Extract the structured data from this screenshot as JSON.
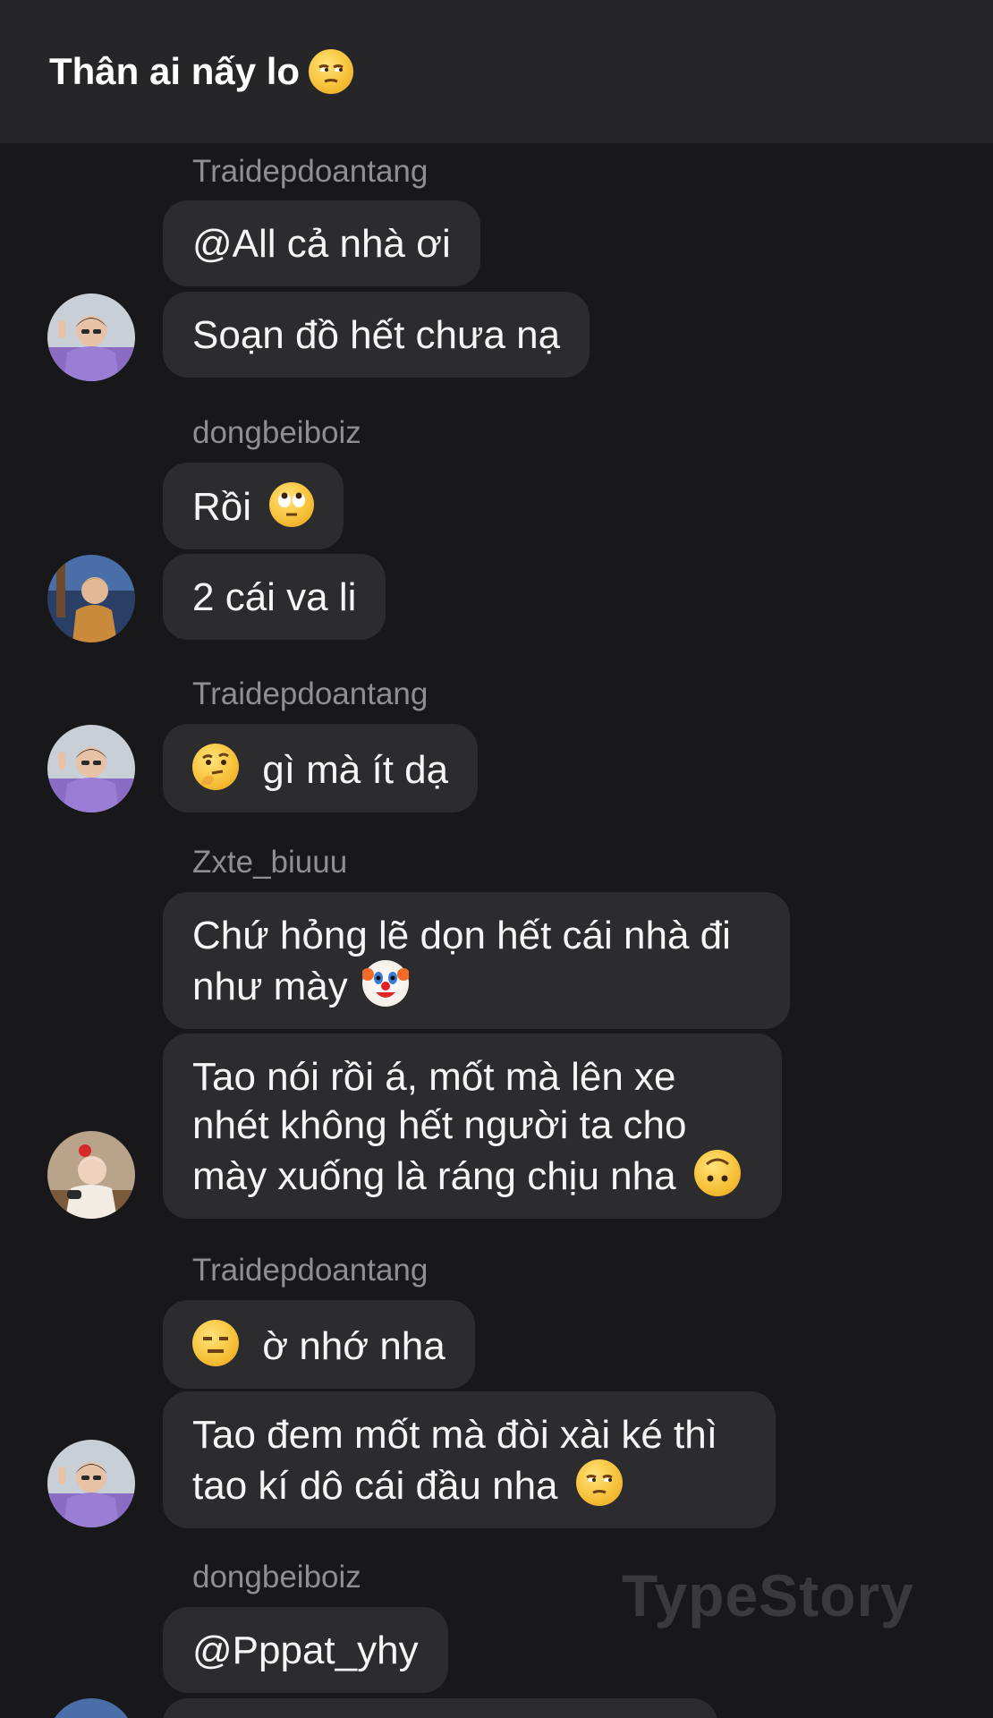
{
  "header": {
    "title": "Thân ai nấy lo",
    "title_emoji": "unamused-face"
  },
  "messages": [
    {
      "sender": "Traidepdoantang",
      "bubbles": [
        "@All cả nhà ơi",
        "Soạn đồ hết chưa nạ"
      ],
      "avatar": "avatar-traidepdoantang"
    },
    {
      "sender": "dongbeiboiz",
      "bubbles": [
        "Rồi",
        "2 cái va li"
      ],
      "emoji_1": "rolling-eyes",
      "avatar": "avatar-dongbeiboiz"
    },
    {
      "sender": "Traidepdoantang",
      "bubbles": [
        "gì mà ít dạ"
      ],
      "emoji_1": "thinking-face",
      "avatar": "avatar-traidepdoantang"
    },
    {
      "sender": "Zxte_biuuu",
      "bubbles": [
        "Chứ hỏng lẽ dọn hết cái nhà đi như mày",
        "Tao nói rồi á, mốt mà lên xe nhét không hết người ta cho mày xuống là ráng chịu nha"
      ],
      "emoji_1": "clown-face",
      "emoji_2": "upside-down-face",
      "avatar": "avatar-zxte"
    },
    {
      "sender": "Traidepdoantang",
      "bubbles": [
        "ờ nhớ nha",
        "Tao đem mốt mà đòi xài ké thì tao kí dô cái đầu nha"
      ],
      "emoji_1": "expressionless-face",
      "emoji_2": "unamused-face",
      "avatar": "avatar-traidepdoantang"
    },
    {
      "sender": "dongbeiboiz",
      "bubbles": [
        "@Pppat_yhy"
      ],
      "avatar": "avatar-dongbeiboiz"
    }
  ],
  "watermark": "TypeStory",
  "colors": {
    "background": "#18181b",
    "header": "#262628",
    "bubble": "#2c2c2e",
    "sender": "#8e8e93"
  }
}
